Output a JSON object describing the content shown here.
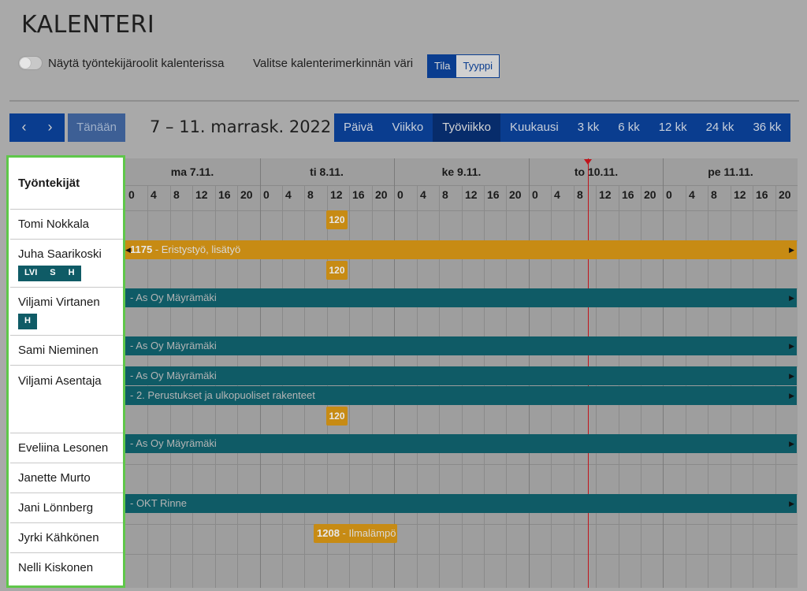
{
  "page": {
    "title": "KALENTERI"
  },
  "options": {
    "roles_toggle_label": "Näytä työntekijäroolit kalenterissa",
    "color_label": "Valitse kalenterimerkinnän väri",
    "color_options": [
      "Tila",
      "Tyyppi"
    ],
    "color_selected": "Tila"
  },
  "toolbar": {
    "prev": "‹",
    "next": "›",
    "today": "Tänään",
    "range": "7 – 11. marrask. 2022",
    "views": [
      "Päivä",
      "Viikko",
      "Työviikko",
      "Kuukausi",
      "3 kk",
      "6 kk",
      "12 kk",
      "24 kk",
      "36 kk"
    ],
    "active_view": "Työviikko"
  },
  "sidebar": {
    "header": "Työntekijät",
    "employees": [
      {
        "name": "Tomi Nokkala",
        "roles": []
      },
      {
        "name": "Juha Saarikoski",
        "roles": [
          "LVI",
          "S",
          "H"
        ]
      },
      {
        "name": "Viljami Virtanen",
        "roles": [
          "H"
        ]
      },
      {
        "name": "Sami Nieminen",
        "roles": []
      },
      {
        "name": "Viljami Asentaja",
        "roles": []
      },
      {
        "name": "Eveliina Lesonen",
        "roles": []
      },
      {
        "name": "Janette Murto",
        "roles": []
      },
      {
        "name": "Jani Lönnberg",
        "roles": []
      },
      {
        "name": "Jyrki Kähkönen",
        "roles": []
      },
      {
        "name": "Nelli Kiskonen",
        "roles": []
      }
    ]
  },
  "calendar": {
    "days": [
      "ma 7.11.",
      "ti 8.11.",
      "ke 9.11.",
      "to 10.11.",
      "pe 11.11."
    ],
    "hours": [
      "0",
      "4",
      "8",
      "12",
      "16",
      "20"
    ],
    "today": "to 10.11.",
    "events": [
      {
        "label": "120"
      },
      {
        "number": "1175",
        "label": " - Eristystyö, lisätyö"
      },
      {
        "label": "120"
      },
      {
        "label": "- As Oy Mäyrämäki"
      },
      {
        "label": "- As Oy Mäyrämäki"
      },
      {
        "label": "- As Oy Mäyrämäki"
      },
      {
        "label": "- 2. Perustukset ja ulkopuoliset rakenteet"
      },
      {
        "label": "120"
      },
      {
        "label": "- As Oy Mäyrämäki"
      },
      {
        "label": "- OKT Rinne"
      },
      {
        "number": "1208",
        "label": " - Ilmalämpö"
      }
    ]
  },
  "colors": {
    "brand": "#0a3d8f",
    "teal": "#0f5b66",
    "orange": "#c78b14",
    "now_line": "#c0141b",
    "highlight": "#5fc74a"
  }
}
